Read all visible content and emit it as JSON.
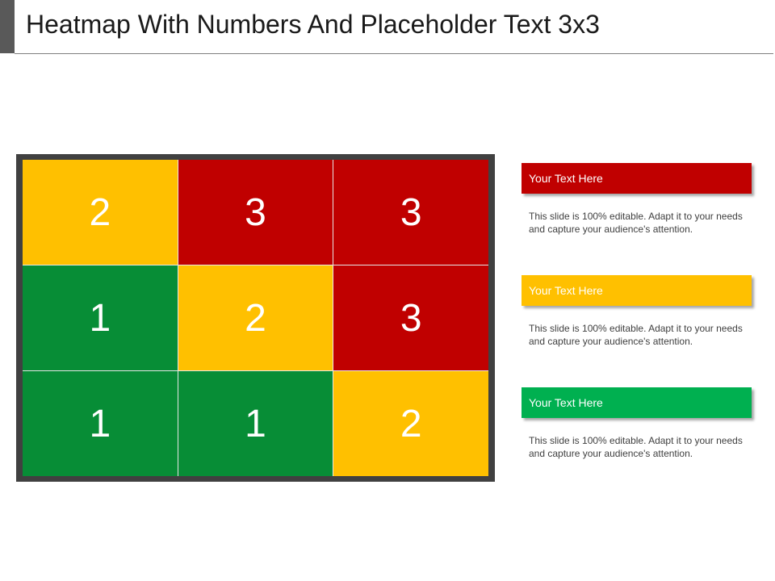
{
  "title": "Heatmap With Numbers And Placeholder Text 3x3",
  "chart_data": {
    "type": "heatmap",
    "rows": 3,
    "cols": 3,
    "values": [
      [
        2,
        3,
        3
      ],
      [
        1,
        2,
        3
      ],
      [
        1,
        1,
        2
      ]
    ],
    "colors": {
      "1": "#078d36",
      "2": "#ffc000",
      "3": "#c00000"
    }
  },
  "legend": [
    {
      "label": "Your Text Here",
      "color": "#c00000",
      "text": "This slide is 100% editable. Adapt it to your needs and capture your audience's attention."
    },
    {
      "label": "Your Text Here",
      "color": "#ffc000",
      "text": "This slide is 100% editable. Adapt it to your needs and capture your audience's attention."
    },
    {
      "label": "Your Text Here",
      "color": "#00b050",
      "text": "This slide is 100% editable. Adapt it to your needs and capture your audience's attention."
    }
  ]
}
